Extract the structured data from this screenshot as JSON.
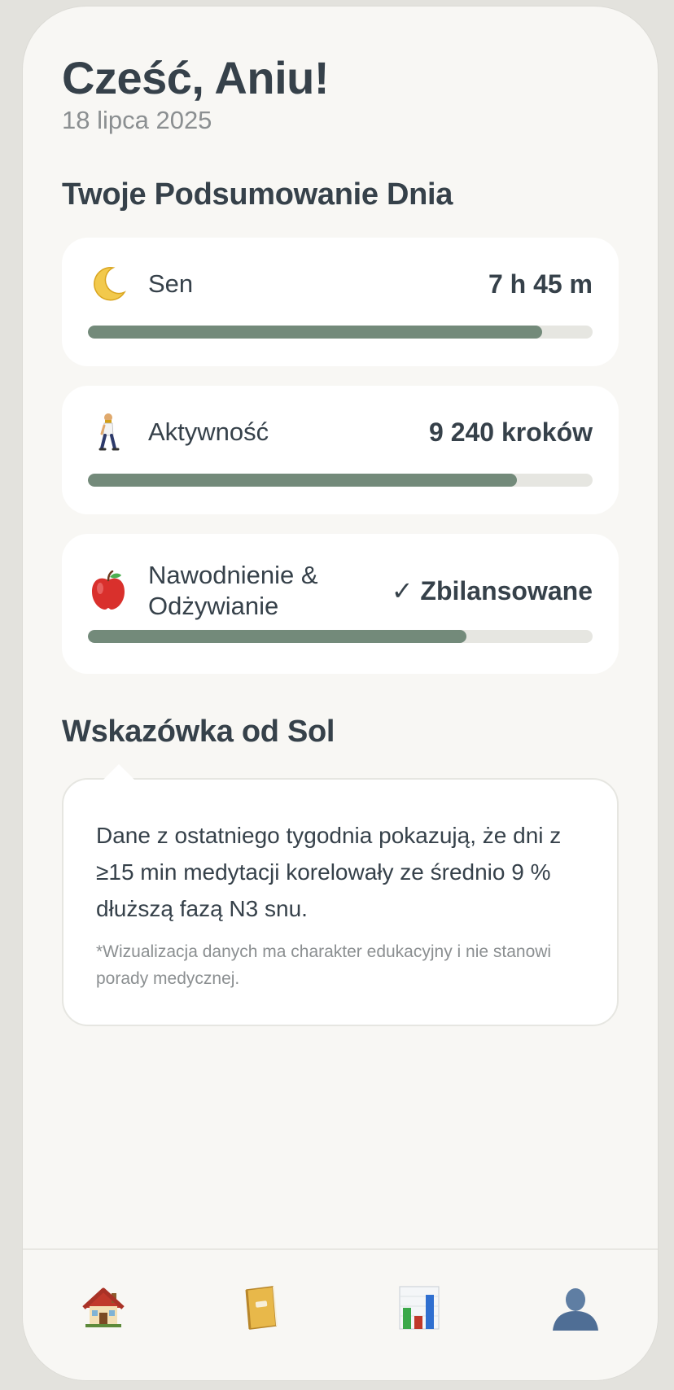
{
  "header": {
    "greeting": "Cześć, Aniu!",
    "date": "18 lipca 2025"
  },
  "summary": {
    "title": "Twoje Podsumowanie Dnia",
    "metrics": [
      {
        "label": "Sen",
        "value": "7 h 45 m",
        "icon": "moon-icon",
        "progress": 0.9
      },
      {
        "label": "Aktywność",
        "value": "9 240 kroków",
        "icon": "walking-person-icon",
        "progress": 0.85
      },
      {
        "label_line1": "Nawodnienie &",
        "label_line2": "Odżywianie",
        "value": "✓ Zbilansowane",
        "icon": "apple-icon",
        "progress": 0.75
      }
    ]
  },
  "tip": {
    "title": "Wskazówka od Sol",
    "text": "Dane z ostatniego tygodnia pokazują, że dni z ≥15 min medytacji korelowały ze średnio 9 % dłuższą fazą N3 snu.",
    "note": "*Wizualizacja danych ma charakter edukacyjny i nie stanowi porady medycznej."
  },
  "tabs": [
    {
      "icon": "home-icon"
    },
    {
      "icon": "journal-icon"
    },
    {
      "icon": "bar-chart-icon"
    },
    {
      "icon": "profile-icon"
    }
  ],
  "colors": {
    "accent": "#738a7a",
    "track": "#e6e6e1",
    "text": "#36414a",
    "muted": "#8b8f91"
  }
}
